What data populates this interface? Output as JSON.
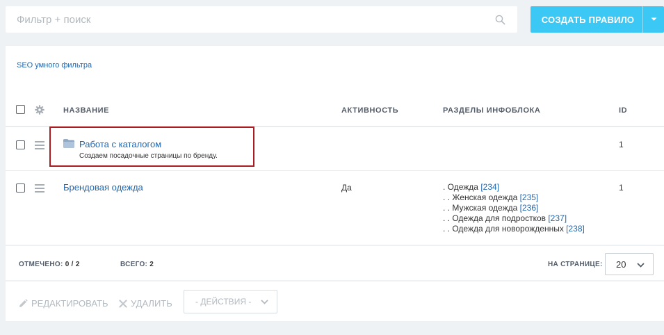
{
  "search": {
    "placeholder": "Фильтр + поиск"
  },
  "toolbar": {
    "create_label": "СОЗДАТЬ ПРАВИЛО"
  },
  "breadcrumb": "SEO умного фильтра",
  "table": {
    "columns": {
      "name": "НАЗВАНИЕ",
      "active": "АКТИВНОСТЬ",
      "sections": "РАЗДЕЛЫ ИНФОБЛОКА",
      "id": "ID"
    },
    "rows": [
      {
        "name": "Работа с каталогом",
        "description": "Создаем посадочные страницы по бренду.",
        "active": "",
        "id": "1"
      },
      {
        "name": "Брендовая одежда",
        "active": "Да",
        "id": "1",
        "sections": [
          {
            "prefix": ". Одежда ",
            "id": "[234]"
          },
          {
            "prefix": ". . Женская одежда ",
            "id": "[235]"
          },
          {
            "prefix": ". . Мужская одежда ",
            "id": "[236]"
          },
          {
            "prefix": ". . Одежда для подростков ",
            "id": "[237]"
          },
          {
            "prefix": ". . Одежда для новорожденных ",
            "id": "[238]"
          }
        ]
      }
    ]
  },
  "footer": {
    "selected_label": "ОТМЕЧЕНО:",
    "selected_value": "0 / 2",
    "total_label": "ВСЕГО:",
    "total_value": "2",
    "per_page_label": "НА СТРАНИЦЕ:",
    "per_page_value": "20"
  },
  "actions": {
    "edit_label": "РЕДАКТИРОВАТЬ",
    "delete_label": "УДАЛИТЬ",
    "actions_select": "- ДЕЙСТВИЯ -"
  },
  "colors": {
    "accent": "#3bc8f5",
    "link": "#2067b0",
    "highlight": "#a81c22"
  }
}
